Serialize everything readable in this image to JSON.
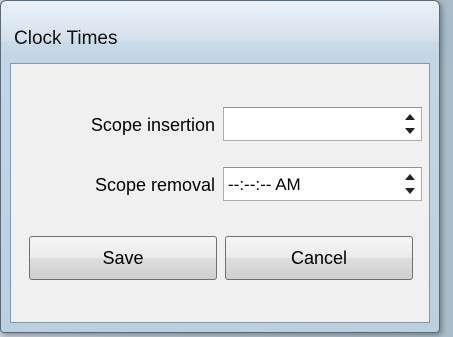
{
  "window": {
    "title": "Clock Times"
  },
  "form": {
    "scope_insertion": {
      "label": "Scope insertion",
      "value": ""
    },
    "scope_removal": {
      "label": "Scope removal",
      "value": "--:--:-- AM"
    }
  },
  "buttons": {
    "save": "Save",
    "cancel": "Cancel"
  },
  "icons": {
    "spinner_up": "triangle-up-icon",
    "spinner_down": "triangle-down-icon"
  }
}
